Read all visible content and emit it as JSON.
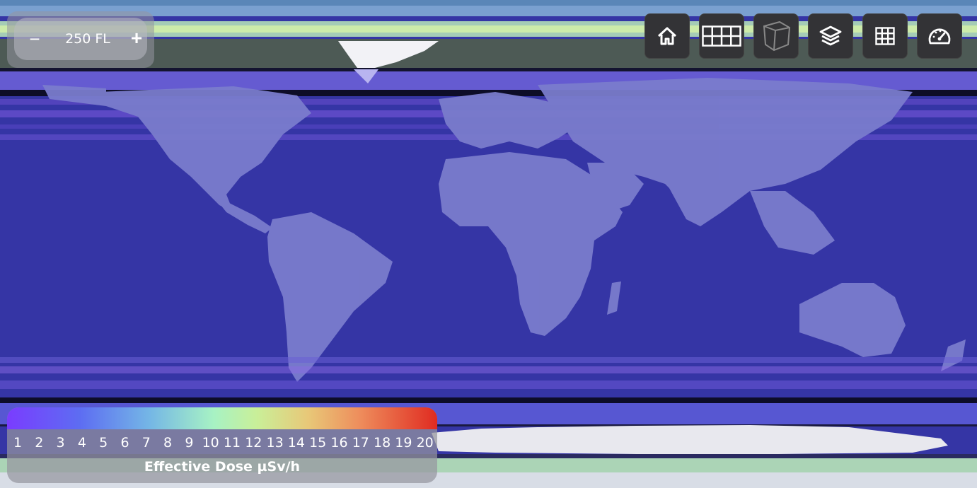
{
  "altitude": {
    "minus_label": "−",
    "value_label": "250 FL",
    "plus_label": "+"
  },
  "toolbar": [
    {
      "name": "home-button",
      "icon": "home-icon"
    },
    {
      "name": "grid-wide-button",
      "icon": "wide-grid-icon"
    },
    {
      "name": "3d-view-button",
      "icon": "cube-icon"
    },
    {
      "name": "layers-button",
      "icon": "layers-icon"
    },
    {
      "name": "grid-button",
      "icon": "grid-icon"
    },
    {
      "name": "dashboard-button",
      "icon": "gauge-icon"
    }
  ],
  "legend": {
    "title": "Effective Dose µSv/h",
    "ticks": [
      "1",
      "2",
      "3",
      "4",
      "5",
      "6",
      "7",
      "8",
      "9",
      "10",
      "11",
      "12",
      "13",
      "14",
      "15",
      "16",
      "17",
      "18",
      "19",
      "20"
    ],
    "colors": [
      "#7a3cff",
      "#5d6df2",
      "#74b6e6",
      "#a7f2c4",
      "#c9ef99",
      "#e8c878",
      "#ee8d5c",
      "#e02b21"
    ]
  },
  "map": {
    "ocean_color": "#3434a4",
    "land_color": "#7777c8",
    "polar_color": "#eeeef2"
  }
}
